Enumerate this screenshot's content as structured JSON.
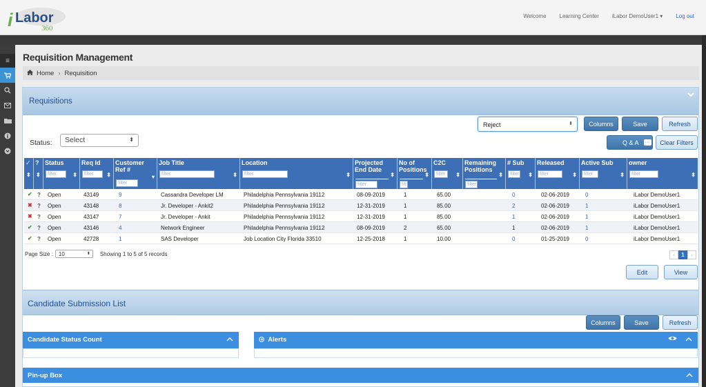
{
  "brand": {
    "name": "Labor",
    "i": "i",
    "sub": "360"
  },
  "topnav": {
    "welcome": "Welcome",
    "learning": "Learning Center",
    "user": "iLabor DemoUser1 ▾",
    "logout": "Log out"
  },
  "page": {
    "title": "Requisition Management",
    "breadcrumb_home": "Home",
    "breadcrumb_sep": "›",
    "breadcrumb_current": "Requisition"
  },
  "panel": {
    "title": "Requisitions"
  },
  "actions": {
    "reject": "Reject",
    "columns": "Columns",
    "save": "Save",
    "refresh": "Refresh",
    "qa": "Q & A",
    "qa_more": "···",
    "clear_filters": "Clear Filters"
  },
  "status_filter": {
    "label": "Status:",
    "value": "Select"
  },
  "table": {
    "headers": [
      "✓",
      "?",
      "Status",
      "Req Id",
      "Customer Ref #",
      "Job Title",
      "Location",
      "Projected End Date",
      "No of Positions",
      "C2C",
      "Remaining Positions",
      "# Sub",
      "Released",
      "Active Sub",
      "owner"
    ],
    "filter_placeholder": "filter",
    "filter_short": "filt",
    "rows": [
      {
        "icon": "check",
        "q": "?",
        "status": "Open",
        "req": "43149",
        "cref": "9",
        "title": "Cassandra Developer LM",
        "loc": "Philadelphia Pennsylvania 19112",
        "end": "08-09-2019",
        "pos": "1",
        "c2c": "65.00",
        "rem": "",
        "sub": "0",
        "rel": "02-06-2019",
        "act": "0",
        "owner": "iLabor DemoUser1"
      },
      {
        "icon": "cross",
        "q": "?",
        "status": "Open",
        "req": "43148",
        "cref": "8",
        "title": "Jr. Developer - Ankit2",
        "loc": "Philadelphia Pennsylvania 19112",
        "end": "12-31-2019",
        "pos": "1",
        "c2c": "85.00",
        "rem": "",
        "sub": "2",
        "rel": "02-06-2019",
        "act": "1",
        "owner": "iLabor DemoUser1"
      },
      {
        "icon": "cross",
        "q": "?",
        "status": "Open",
        "req": "43147",
        "cref": "7",
        "title": "Jr. Developer - Ankit",
        "loc": "Philadelphia Pennsylvania 19112",
        "end": "12-31-2019",
        "pos": "1",
        "c2c": "85.00",
        "rem": "",
        "sub": "1",
        "rel": "02-06-2019",
        "act": "1",
        "owner": "iLabor DemoUser1"
      },
      {
        "icon": "check",
        "q": "?",
        "status": "Open",
        "req": "43146",
        "cref": "4",
        "title": "Network Engineer",
        "loc": "Philadelphia Pennsylvania 19112",
        "end": "08-09-2019",
        "pos": "2",
        "c2c": "65.00",
        "rem": "",
        "sub": "1",
        "rel": "02-06-2019",
        "act": "1",
        "owner": "iLabor DemoUser1"
      },
      {
        "icon": "check",
        "q": "?",
        "status": "Open",
        "req": "42728",
        "cref": "1",
        "title": "SAS Developer",
        "loc": "Job Location City Florida 33510",
        "end": "12-25-2018",
        "pos": "1",
        "c2c": "10.00",
        "rem": "",
        "sub": "0",
        "rel": "01-25-2019",
        "act": "0",
        "owner": "iLabor DemoUser1"
      }
    ]
  },
  "pager": {
    "label": "Page Size :",
    "size": "10",
    "info": "Showing 1 to 5 of 5 records",
    "prev": "‹",
    "current": "1",
    "next": "›"
  },
  "row_actions": {
    "edit": "Edit",
    "view": "View"
  },
  "submission": {
    "title": "Candidate Submission List",
    "columns": "Columns",
    "save": "Save",
    "refresh": "Refresh"
  },
  "widgets": {
    "status_count": "Candidate Status Count",
    "alerts": "Alerts",
    "pinup": "Pin-up Box"
  }
}
